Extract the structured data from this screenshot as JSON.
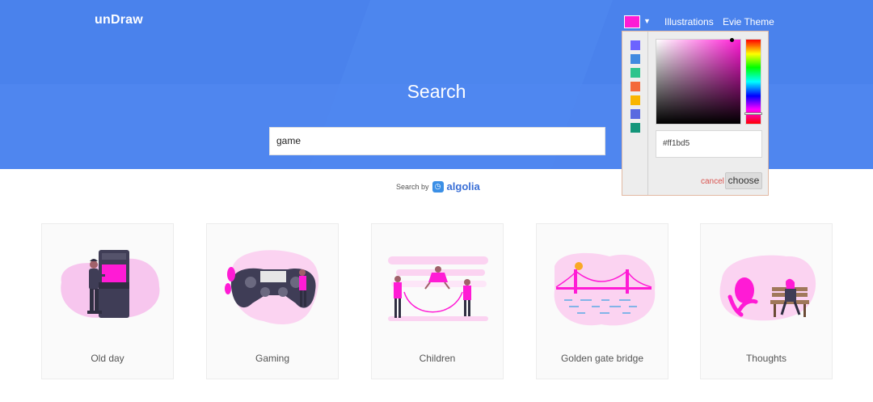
{
  "header": {
    "logo": "unDraw",
    "nav_illustrations": "Illustrations",
    "nav_theme": "Evie Theme",
    "title": "Search",
    "accent": "#ff1bd5",
    "bg": "#4f86ef"
  },
  "search": {
    "value": "game",
    "by_label": "Search by",
    "provider": "algolia"
  },
  "cards": [
    {
      "label": "Old day",
      "art": "arcade-illustration"
    },
    {
      "label": "Gaming",
      "art": "gamepad-illustration"
    },
    {
      "label": "Children",
      "art": "children-illustration"
    },
    {
      "label": "Golden gate bridge",
      "art": "bridge-illustration"
    },
    {
      "label": "Thoughts",
      "art": "bench-illustration"
    }
  ],
  "picker": {
    "swatches": [
      "#6c63ff",
      "#3f8ae0",
      "#2ec48d",
      "#f4693a",
      "#f9b500",
      "#5a6ae0",
      "#14967a"
    ],
    "hex_value": "#ff1bd5",
    "cancel_label": "cancel",
    "choose_label": "choose"
  }
}
